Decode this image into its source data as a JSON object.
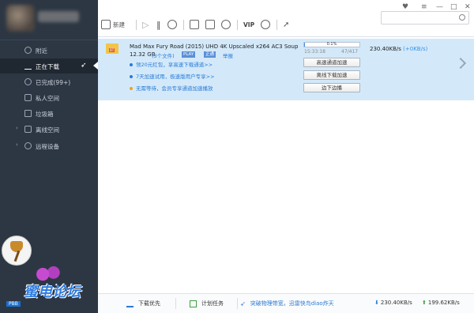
{
  "sidebar": {
    "items": [
      {
        "label": "附近"
      },
      {
        "label": "正在下载"
      },
      {
        "label": "已完成(99+)"
      },
      {
        "label": "私人空间"
      },
      {
        "label": "垃圾箱"
      },
      {
        "label": "离线空间"
      },
      {
        "label": "远程设备"
      }
    ],
    "logo_text": "蜜电论坛",
    "logo_sub": "PBB"
  },
  "toolbar": {
    "new_label": "新建",
    "vip_label": "VIP"
  },
  "task": {
    "name": "Mad Max Fury Road (2015) UHD 4K Upscaled x264 AC3 Soup",
    "size": "12.32 GB",
    "file_count": "(3个文件)",
    "play_tag": "PLAY",
    "ok_tag": "正通",
    "report_label": "举报",
    "promos": [
      {
        "text": "领20元红包，享高速下载通道>>",
        "color": "#2a7bd6"
      },
      {
        "text": "7天加速试用，极速版用户专享>>",
        "color": "#2a7bd6"
      },
      {
        "text": "无需等待，会员专享通道加速播放",
        "color": "#2a7bd6"
      }
    ],
    "progress_text": "0.1%",
    "progress": 0.001,
    "time": "15:33:18",
    "count": "47/417",
    "speed": "230.40KB/s",
    "speed_extra": "(+0KB/s)",
    "btn_fast": "高速通道加速",
    "btn_offline": "离线下载加速",
    "btn_play": "边下边播"
  },
  "status": {
    "priority": "下载优先",
    "plan": "计划任务",
    "notice": "突破物理带宽，迅雷快鸟diao炸天",
    "down_speed": "230.40KB/s",
    "up_speed": "199.62KB/s"
  },
  "colors": {
    "sidebar_bg": "#2d3744",
    "task_bg": "#d3e9fa",
    "accent": "#2a7bd6"
  }
}
